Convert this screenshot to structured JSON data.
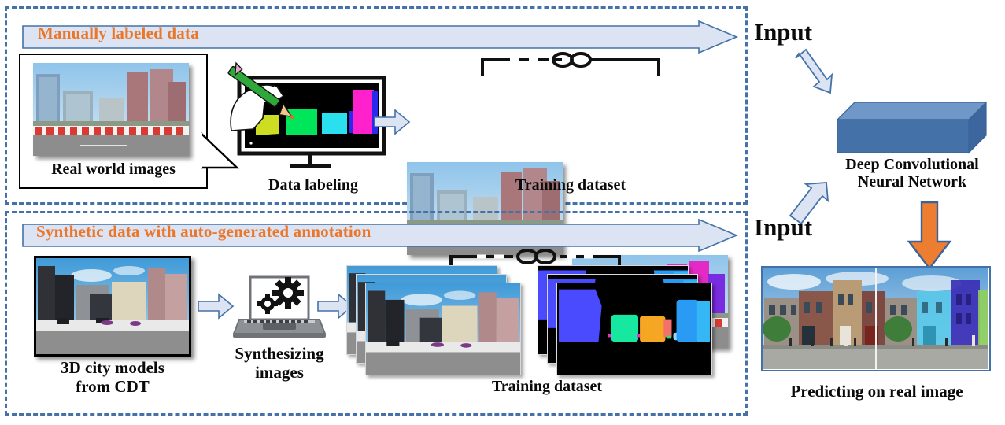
{
  "figure": {
    "title": "Training pipeline with manually labeled and synthetic data",
    "accent_orange": "#ec7628",
    "accent_blue": "#4472a8",
    "banner_fill": "#dce3f2",
    "dashed_border": "#4472a8"
  },
  "top_panel": {
    "banner_label": "Manually labeled data",
    "real_world": {
      "caption": "Real world images"
    },
    "labeling": {
      "caption": "Data labeling",
      "icons": [
        "monitor-icon",
        "hand-icon",
        "pencil-icon"
      ],
      "segment_colors": [
        "#ccdd22",
        "#00e65a",
        "#2ae0ee",
        "#ff22cc",
        "#2a2aee"
      ]
    },
    "training": {
      "caption": "Training dataset",
      "link_icon": "chain-link-icon",
      "overlay_colors": [
        "#b7e92a",
        "#2fd95f",
        "#35dcd6",
        "#ee2ad0",
        "#7a2ce0"
      ]
    }
  },
  "bottom_panel": {
    "banner_label": "Synthetic data with auto-generated annotation",
    "city_models": {
      "caption": "3D city models\nfrom CDT"
    },
    "synthesizing": {
      "caption": "Synthesizing\nimages",
      "icon": "laptop-gears-icon"
    },
    "training": {
      "caption": "Training dataset",
      "link_icon": "chain-link-icon",
      "segment_colors": [
        "#4a4aff",
        "#16e8a0",
        "#f5a623",
        "#f4706a",
        "#2a9bf5",
        "#8fd9f5"
      ]
    }
  },
  "right_column": {
    "input_top_label": "Input",
    "input_bottom_label": "Input",
    "network_label": "Deep Convolutional\nNeural Network",
    "prediction_caption": "Predicting on real image",
    "network_box_color": "#4472a8",
    "network_box_top_color": "#6f97c8",
    "output_arrow_color": "#ed7d31",
    "prediction_overlay_colors": [
      "#5ac8e8",
      "#3b2fb5",
      "#8fcf5a"
    ]
  },
  "arrows": {
    "small_right_1": "arrow-right-icon",
    "small_right_2": "arrow-right-icon",
    "small_right_3": "arrow-right-icon",
    "input_top": "arrow-down-right-icon",
    "input_bottom": "arrow-up-right-icon",
    "output_down": "arrow-down-icon"
  }
}
